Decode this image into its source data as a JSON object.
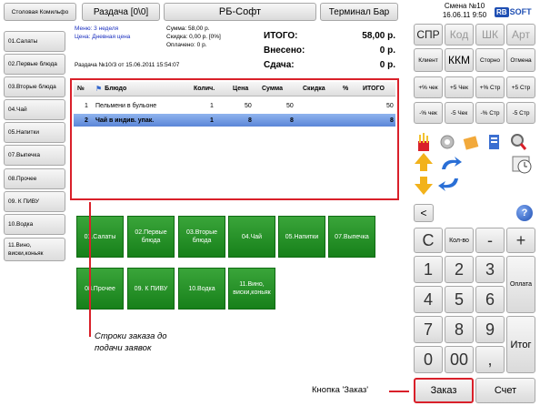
{
  "header": {
    "restaurant_btn": "Столовая Комильфо",
    "handout_btn": "Раздача [0\\0]",
    "app_title": "РБ-Софт",
    "terminal_btn": "Терминал Бар"
  },
  "shift": {
    "label": "Смена №10",
    "datetime": "16.06.11 9:50",
    "logo_rb": "RB",
    "logo_soft": "SOFT"
  },
  "info": {
    "menu": "Меню: 3 неделя",
    "price": "Цена: Дневная цена",
    "sum": "Сумма: 58,00 р.",
    "discount": "Скидка: 0,00 р. [0%]",
    "paid": "Оплачено: 0 р.",
    "order_title": "Раздача №10/3 от 15.06.2011 15:54:07"
  },
  "totals": {
    "total_label": "ИТОГО:",
    "total_value": "58,00 р.",
    "deposited_label": "Внесено:",
    "deposited_value": "0 р.",
    "change_label": "Сдача:",
    "change_value": "0 р."
  },
  "categories": [
    "01.Салаты",
    "02.Первые блюда",
    "03.Вторые блюда",
    "04.Чай",
    "05.Напитки",
    "07.Выпечка",
    "08.Прочее",
    "09. К ПИВУ",
    "10.Водка",
    "11.Вино, виски,коньяк"
  ],
  "table": {
    "columns": [
      "№",
      "Блюдо",
      "Колич.",
      "Цена",
      "Сумма",
      "Скидка",
      "%",
      "ИТОГО"
    ],
    "rows": [
      {
        "n": "1",
        "dish": "Пельмени в бульоне",
        "qty": "1",
        "price": "50",
        "sum": "50",
        "discount": "",
        "pct": "",
        "total": "50"
      },
      {
        "n": "2",
        "dish": "Чай в индив. упак.",
        "qty": "1",
        "price": "8",
        "sum": "8",
        "discount": "",
        "pct": "",
        "total": "8"
      }
    ]
  },
  "grid": {
    "row1": [
      "01.Салаты",
      "02.Первые блюда",
      "03.Вторые блюда",
      "04.Чай",
      "05.Напитки",
      "07.Выпечка"
    ],
    "row2": [
      "08.Прочее",
      "09. К ПИВУ",
      "10.Водка",
      "11.Вино, виски,коньяк"
    ]
  },
  "right_panel": {
    "tabs": [
      "СПР",
      "Код",
      "ШК",
      "Арт"
    ],
    "row2": [
      "Клиент",
      "ККМ",
      "Сторно",
      "Отмена"
    ],
    "row3": [
      "+% чек",
      "+5 Чек",
      "+% Стр",
      "+5 Стр"
    ],
    "row4": [
      "-% чек",
      "-5 Чек",
      "-% Стр",
      "-5 Стр"
    ],
    "back": "<",
    "help": "?",
    "keypad": {
      "c": "C",
      "qty": "Кол-во",
      "minus": "-",
      "plus": "+",
      "d1": "1",
      "d2": "2",
      "d3": "3",
      "d4": "4",
      "d5": "5",
      "d6": "6",
      "d7": "7",
      "d8": "8",
      "d9": "9",
      "d0": "0",
      "d00": "00",
      "comma": ",",
      "pay": "Оплата",
      "total": "Итог"
    },
    "order_btn": "Заказ",
    "bill_btn": "Счет"
  },
  "annotations": {
    "rows_note": "Строки заказа до подачи заявок",
    "order_btn_note": "Кнопка 'Заказ'"
  },
  "colors": {
    "accent_red": "#d9202a",
    "green": "#17801a",
    "selection_blue": "#5b85d8",
    "info_blue": "#1a2fbf"
  }
}
